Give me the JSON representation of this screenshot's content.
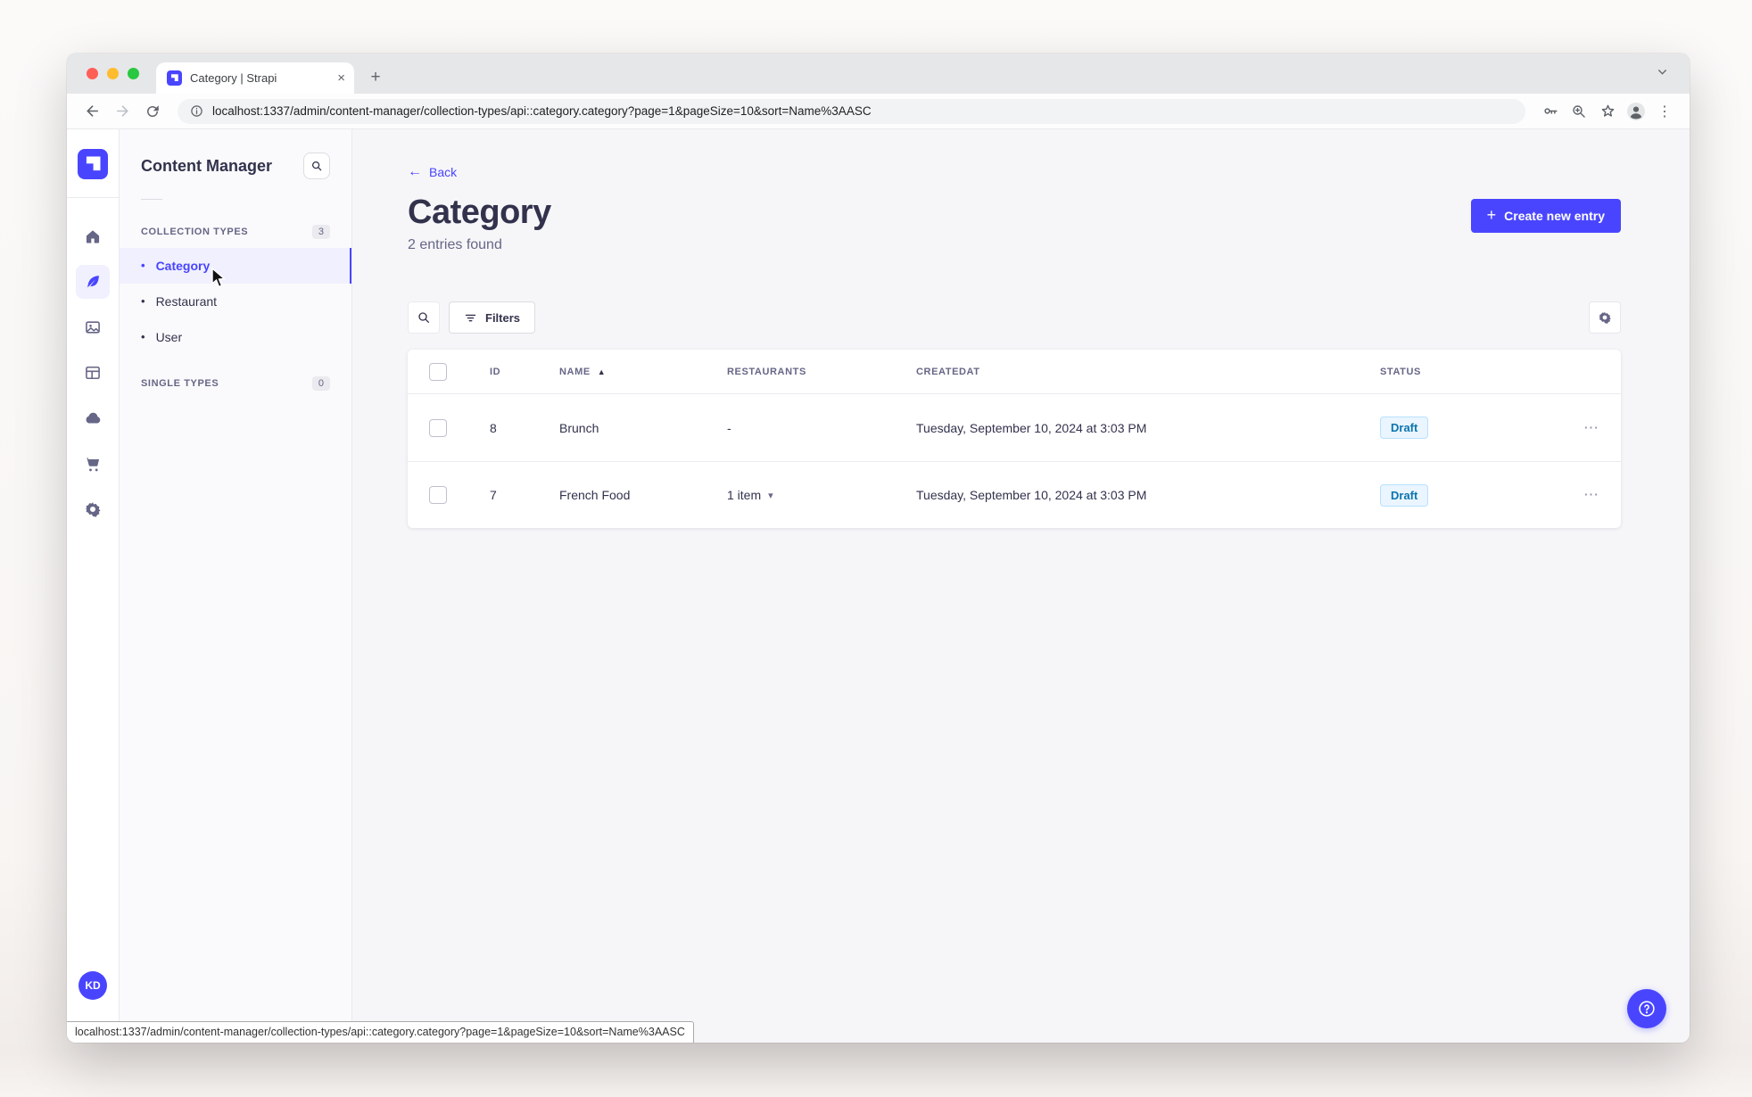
{
  "browser": {
    "tab_title": "Category | Strapi",
    "url": "localhost:1337/admin/content-manager/collection-types/api::category.category?page=1&pageSize=10&sort=Name%3AASC"
  },
  "statusbar": {
    "url": "localhost:1337/admin/content-manager/collection-types/api::category.category?page=1&pageSize=10&sort=Name%3AASC"
  },
  "icons": {
    "close": "×",
    "plus": "+",
    "kebab": "⋮",
    "ellipsis": "⋯",
    "bullet": "•",
    "back_arrow": "←",
    "sort_asc": "▲",
    "chevron_down": "▾"
  },
  "sidebar": {
    "avatar_initials": "KD"
  },
  "subnav": {
    "title": "Content Manager",
    "sections": [
      {
        "label": "COLLECTION TYPES",
        "badge": "3",
        "items": [
          {
            "label": "Category",
            "active": true
          },
          {
            "label": "Restaurant",
            "active": false
          },
          {
            "label": "User",
            "active": false
          }
        ]
      },
      {
        "label": "SINGLE TYPES",
        "badge": "0",
        "items": []
      }
    ]
  },
  "main": {
    "back_label": "Back",
    "title": "Category",
    "subtitle": "2 entries found",
    "create_button": "Create new entry",
    "filters_button": "Filters"
  },
  "table": {
    "headers": {
      "id": "ID",
      "name": "NAME",
      "restaurants": "RESTAURANTS",
      "createdat": "CREATEDAT",
      "status": "STATUS"
    },
    "rows": [
      {
        "id": "8",
        "name": "Brunch",
        "restaurants": "-",
        "createdat": "Tuesday, September 10, 2024 at 3:03 PM",
        "status": "Draft"
      },
      {
        "id": "7",
        "name": "French Food",
        "restaurants": "1 item",
        "createdat": "Tuesday, September 10, 2024 at 3:03 PM",
        "status": "Draft"
      }
    ]
  },
  "colors": {
    "accent": "#4945ff",
    "active_bg": "#f0f0ff",
    "draft_bg": "#eaf5ff",
    "draft_border": "#b8e1ff",
    "draft_text": "#0c75af"
  }
}
